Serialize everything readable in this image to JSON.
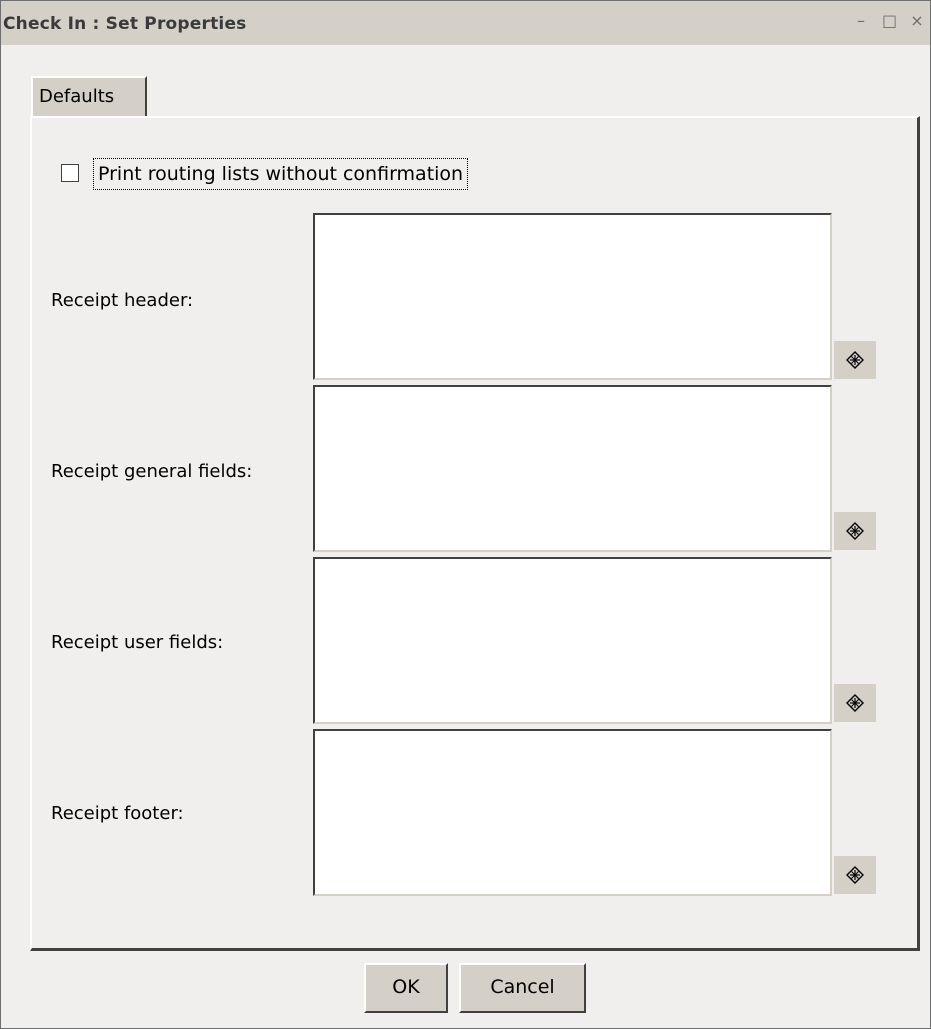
{
  "window": {
    "title": "Check In : Set Properties",
    "controls": {
      "minimize": "–",
      "maximize": "□",
      "close": "×"
    }
  },
  "tabs": [
    {
      "label": "Defaults",
      "selected": true
    }
  ],
  "options": {
    "print_routing_label": "Print routing lists without confirmation",
    "print_routing_checked": false
  },
  "fields": [
    {
      "label": "Receipt header:",
      "value": "",
      "button_icon": "insert-field-icon"
    },
    {
      "label": "Receipt general fields:",
      "value": "",
      "button_icon": "insert-field-icon"
    },
    {
      "label": "Receipt user fields:",
      "value": "",
      "button_icon": "insert-field-icon"
    },
    {
      "label": "Receipt footer:",
      "value": "",
      "button_icon": "insert-field-icon"
    }
  ],
  "buttons": {
    "ok": "OK",
    "cancel": "Cancel"
  }
}
